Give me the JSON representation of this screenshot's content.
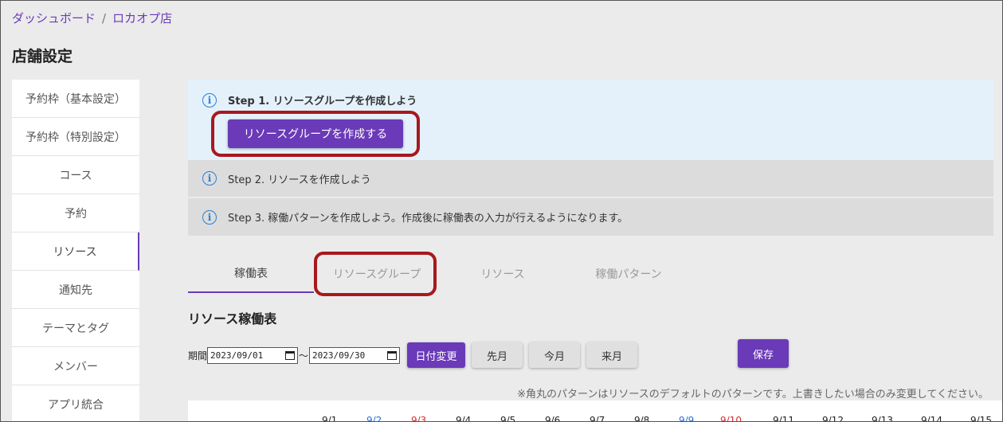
{
  "breadcrumb": {
    "home": "ダッシュボード",
    "separator": "/",
    "current": "ロカオプ店"
  },
  "page_title": "店舗設定",
  "sidebar": {
    "items": [
      {
        "label": "予約枠（基本設定）"
      },
      {
        "label": "予約枠（特別設定）"
      },
      {
        "label": "コース"
      },
      {
        "label": "予約"
      },
      {
        "label": "リソース"
      },
      {
        "label": "通知先"
      },
      {
        "label": "テーマとタグ"
      },
      {
        "label": "メンバー"
      },
      {
        "label": "アプリ統合"
      }
    ],
    "active_index": 4
  },
  "steps": {
    "step1": {
      "text": "Step 1. リソースグループを作成しよう",
      "button": "リソースグループを作成する"
    },
    "step2": {
      "text": "Step 2. リソースを作成しよう"
    },
    "step3": {
      "text": "Step 3. 稼働パターンを作成しよう。作成後に稼働表の入力が行えるようになります。"
    }
  },
  "tabs": [
    {
      "label": "稼働表"
    },
    {
      "label": "リソースグループ"
    },
    {
      "label": "リソース"
    },
    {
      "label": "稼働パターン"
    }
  ],
  "section_title": "リソース稼働表",
  "period": {
    "label": "期間",
    "start": "2023/09/01",
    "end": "2023/09/30",
    "tilde": "〜",
    "change_button": "日付変更",
    "prev_button": "先月",
    "this_button": "今月",
    "next_button": "来月",
    "save_button": "保存"
  },
  "note": "※角丸のパターンはリソースのデフォルトのパターンです。上書きしたい場合のみ変更してください。",
  "date_headers": [
    "9/1",
    "9/2",
    "9/3",
    "9/4",
    "9/5",
    "9/6",
    "9/7",
    "9/8",
    "9/9",
    "9/10",
    "9/11",
    "9/12",
    "9/13",
    "9/14",
    "9/15"
  ],
  "colors": {
    "accent": "#6a3ab8",
    "highlight": "#a8181d",
    "info": "#2a7fd4",
    "saturday": "#2a6fd1",
    "sunday": "#d32f2f"
  }
}
